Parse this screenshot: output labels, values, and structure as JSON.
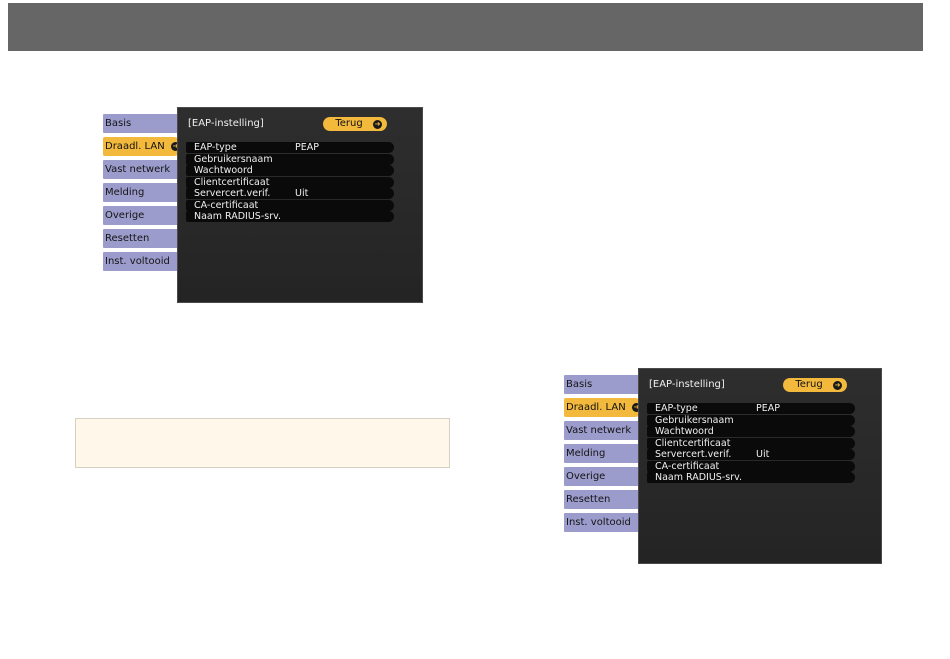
{
  "panels": [
    {
      "tabs": [
        {
          "label": "Basis",
          "active": false
        },
        {
          "label": "Draadl. LAN",
          "active": true
        },
        {
          "label": "Vast netwerk",
          "active": false
        },
        {
          "label": "Melding",
          "active": false
        },
        {
          "label": "Overige",
          "active": false
        },
        {
          "label": "Resetten",
          "active": false
        },
        {
          "label": "Inst. voltooid",
          "active": false
        }
      ],
      "screen": {
        "title": "[EAP-instelling]",
        "back_label": "Terug",
        "rows": [
          {
            "label": "EAP-type",
            "value": "PEAP"
          },
          {
            "label": "Gebruikersnaam",
            "value": ""
          },
          {
            "label": "Wachtwoord",
            "value": ""
          },
          {
            "label": "Clientcertificaat",
            "value": ""
          },
          {
            "label": "Servercert.verif.",
            "value": "Uit"
          },
          {
            "label": "CA-certificaat",
            "value": ""
          },
          {
            "label": "Naam RADIUS-srv.",
            "value": ""
          }
        ]
      }
    },
    {
      "tabs": [
        {
          "label": "Basis",
          "active": false
        },
        {
          "label": "Draadl. LAN",
          "active": true
        },
        {
          "label": "Vast netwerk",
          "active": false
        },
        {
          "label": "Melding",
          "active": false
        },
        {
          "label": "Overige",
          "active": false
        },
        {
          "label": "Resetten",
          "active": false
        },
        {
          "label": "Inst. voltooid",
          "active": false
        }
      ],
      "screen": {
        "title": "[EAP-instelling]",
        "back_label": "Terug",
        "rows": [
          {
            "label": "EAP-type",
            "value": "PEAP"
          },
          {
            "label": "Gebruikersnaam",
            "value": ""
          },
          {
            "label": "Wachtwoord",
            "value": ""
          },
          {
            "label": "Clientcertificaat",
            "value": ""
          },
          {
            "label": "Servercert.verif.",
            "value": "Uit"
          },
          {
            "label": "CA-certificaat",
            "value": ""
          },
          {
            "label": "Naam RADIUS-srv.",
            "value": ""
          }
        ]
      }
    }
  ],
  "colors": {
    "header_bar": "#666666",
    "tab": "#9c9ccc",
    "tab_active": "#f2b93c",
    "screen_bg": "#2b2b2b",
    "note_bg": "#fff8ea"
  },
  "icons": {
    "enter": "enter-icon"
  }
}
